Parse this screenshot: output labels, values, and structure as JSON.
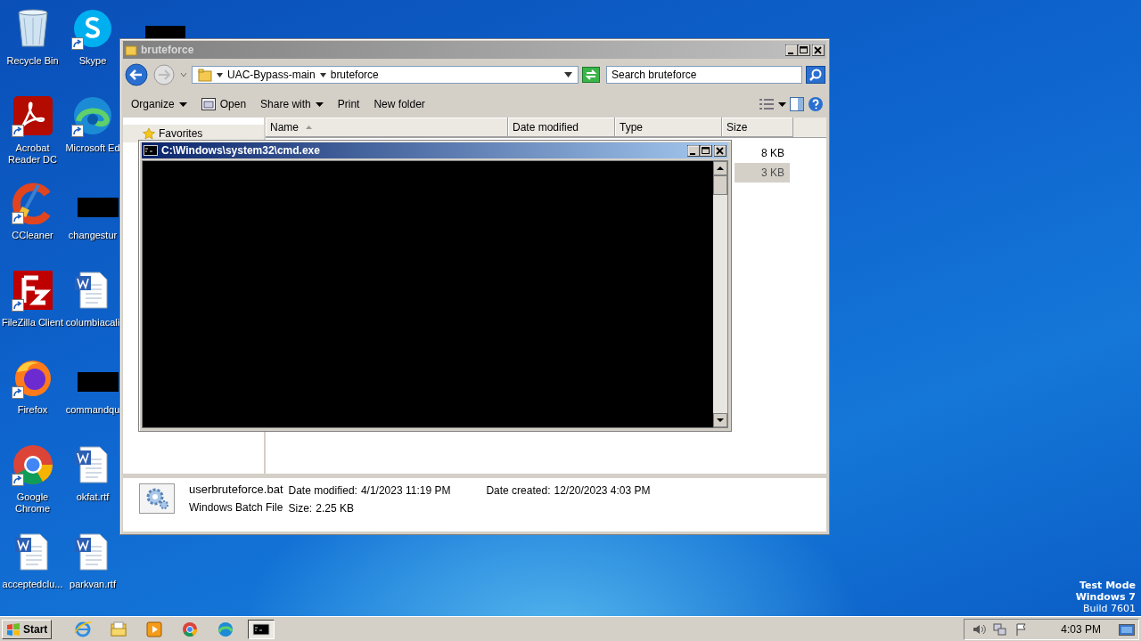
{
  "desktop": {
    "icons": [
      {
        "label": "Recycle Bin",
        "kind": "recycle",
        "shortcut": false
      },
      {
        "label": "Acrobat Reader DC",
        "kind": "acrobat",
        "shortcut": true
      },
      {
        "label": "CCleaner",
        "kind": "ccleaner",
        "shortcut": true
      },
      {
        "label": "FileZilla Client",
        "kind": "filezilla",
        "shortcut": true
      },
      {
        "label": "Firefox",
        "kind": "firefox",
        "shortcut": true
      },
      {
        "label": "Google Chrome",
        "kind": "chrome",
        "shortcut": true
      },
      {
        "label": "acceptedclu...",
        "kind": "word",
        "shortcut": false
      },
      {
        "label": "Skype",
        "kind": "skype",
        "shortcut": true
      },
      {
        "label": "Microsoft Ed",
        "kind": "edge",
        "shortcut": true
      },
      {
        "label": "changestur",
        "kind": "redacted",
        "shortcut": false
      },
      {
        "label": "columbiacali",
        "kind": "word",
        "shortcut": false
      },
      {
        "label": "commandqu",
        "kind": "redacted",
        "shortcut": false
      },
      {
        "label": "okfat.rtf",
        "kind": "word",
        "shortcut": false
      },
      {
        "label": "parkvan.rtf",
        "kind": "word",
        "shortcut": false
      }
    ],
    "os_notice": [
      "Test Mode",
      "Windows 7",
      "Build 7601"
    ]
  },
  "explorer": {
    "title": "bruteforce",
    "breadcrumb": [
      "UAC-Bypass-main",
      "bruteforce"
    ],
    "search": {
      "placeholder": "Search bruteforce"
    },
    "toolbar": [
      {
        "label": "Organize",
        "kind": "menu"
      },
      {
        "label": "Open",
        "kind": "icon"
      },
      {
        "label": "Share with",
        "kind": "menu"
      },
      {
        "label": "Print",
        "kind": "plain"
      },
      {
        "label": "New folder",
        "kind": "plain"
      }
    ],
    "nav": [
      {
        "label": "Favorites"
      }
    ],
    "columns": [
      "Name",
      "Date modified",
      "Type",
      "Size"
    ],
    "files": [
      {
        "size": "8 KB",
        "selected": false
      },
      {
        "size": "3 KB",
        "selected": true
      }
    ],
    "details": {
      "name": "userbruteforce.bat",
      "type": "Windows Batch File",
      "fields": [
        {
          "label": "Date modified:",
          "value": "4/1/2023 11:19 PM"
        },
        {
          "label": "Size:",
          "value": "2.25 KB"
        },
        {
          "label": "Date created:",
          "value": "12/20/2023 4:03 PM"
        }
      ]
    }
  },
  "console": {
    "title": "C:\\Windows\\system32\\cmd.exe"
  },
  "taskbar": {
    "start": "Start",
    "apps": [
      {
        "kind": "ie",
        "active": false
      },
      {
        "kind": "folder",
        "active": false
      },
      {
        "kind": "media",
        "active": false
      },
      {
        "kind": "chrome",
        "active": false
      },
      {
        "kind": "edge",
        "active": false
      },
      {
        "kind": "cmd",
        "active": true
      }
    ],
    "clock": "4:03 PM"
  }
}
